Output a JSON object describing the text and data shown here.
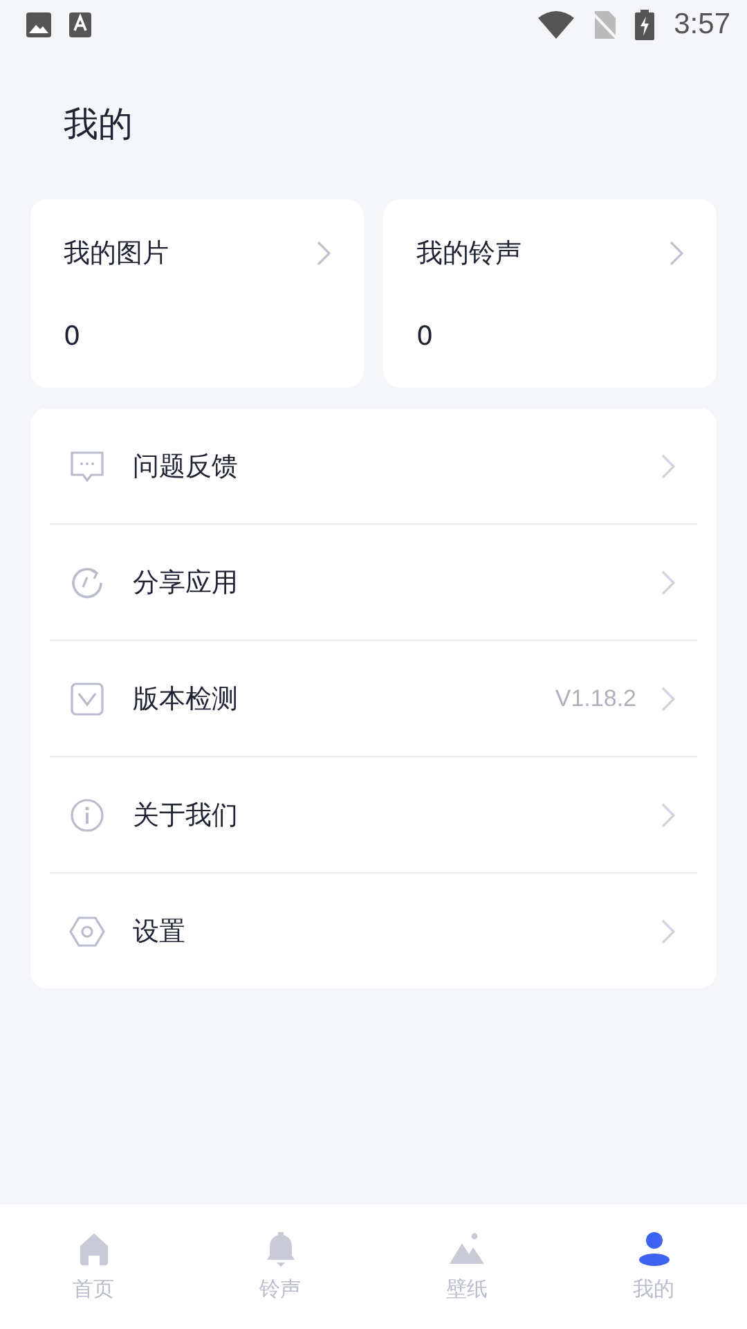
{
  "status_bar": {
    "time": "3:57"
  },
  "title": "我的",
  "stat_cards": [
    {
      "label": "我的图片",
      "count": "0"
    },
    {
      "label": "我的铃声",
      "count": "0"
    }
  ],
  "menu": [
    {
      "label": "问题反馈"
    },
    {
      "label": "分享应用"
    },
    {
      "label": "版本检测",
      "value": "V1.18.2"
    },
    {
      "label": "关于我们"
    },
    {
      "label": "设置"
    }
  ],
  "bottom_nav": [
    {
      "label": "首页",
      "selected": false
    },
    {
      "label": "铃声",
      "selected": false
    },
    {
      "label": "壁纸",
      "selected": false
    },
    {
      "label": "我的",
      "selected": true
    }
  ]
}
